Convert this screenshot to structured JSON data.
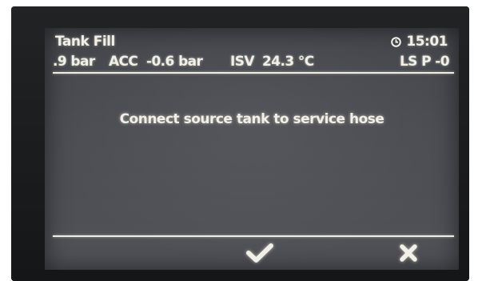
{
  "screen": {
    "title": "Tank Fill",
    "clock": "15:01"
  },
  "status": {
    "pressure": ".9 bar",
    "acc_label": "ACC",
    "acc_value": "-0.6 bar",
    "isv_label": "ISV",
    "isv_value": "24.3 °C",
    "ls_label": "LS P -0"
  },
  "message": "Connect source tank to service hose",
  "softkeys": {
    "confirm_icon": "checkmark-icon",
    "cancel_icon": "cross-icon"
  },
  "colors": {
    "screen_bg": "#4a4b51",
    "text": "#f1efe7"
  }
}
